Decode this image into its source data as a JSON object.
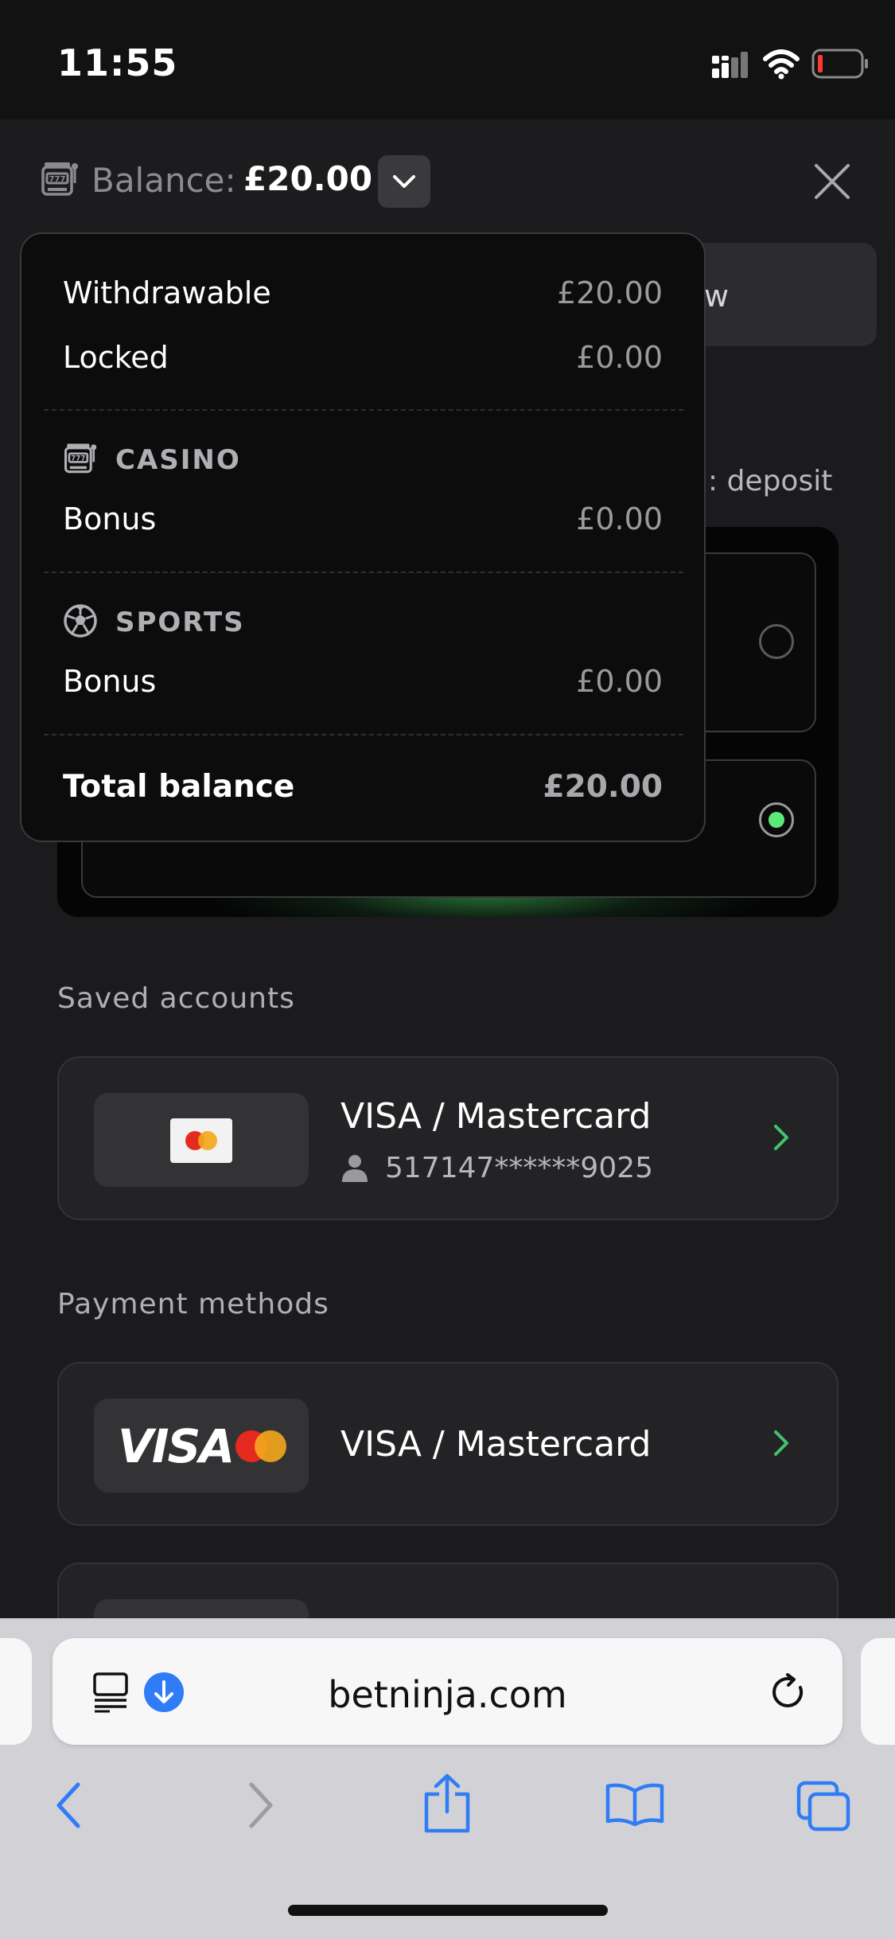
{
  "status_bar": {
    "time": "11:55"
  },
  "header": {
    "balance_label": "Balance:",
    "balance_amount": "£20.00"
  },
  "background": {
    "withdraw_button_partial": "w",
    "subtitle_partial": ": deposit"
  },
  "balance_dropdown": {
    "rows": [
      {
        "label": "Withdrawable",
        "value": "£20.00"
      },
      {
        "label": "Locked",
        "value": "£0.00"
      }
    ],
    "casino": {
      "title": "CASINO",
      "bonus_label": "Bonus",
      "bonus_value": "£0.00"
    },
    "sports": {
      "title": "SPORTS",
      "bonus_label": "Bonus",
      "bonus_value": "£0.00"
    },
    "total": {
      "label": "Total balance",
      "value": "£20.00"
    }
  },
  "saved_accounts": {
    "title": "Saved accounts",
    "items": [
      {
        "name": "VISA / Mastercard",
        "number": "517147******9025"
      }
    ]
  },
  "payment_methods": {
    "title": "Payment methods",
    "items": [
      {
        "name": "VISA / Mastercard",
        "logo_text": "VISA"
      }
    ]
  },
  "browser": {
    "url": "betninja.com"
  },
  "colors": {
    "accent_green": "#5de97a",
    "chevron_green": "#3ec46d",
    "safari_blue": "#2f7cf6"
  }
}
